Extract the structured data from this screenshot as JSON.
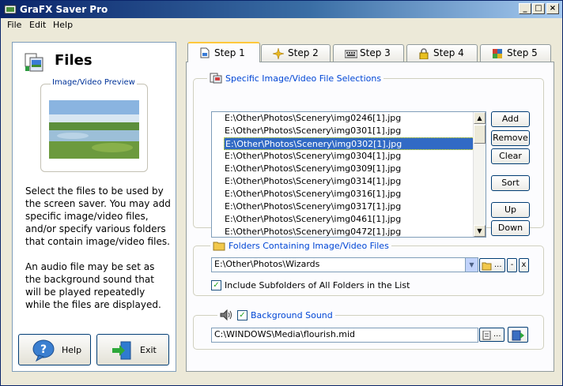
{
  "window": {
    "title": "GraFX Saver Pro",
    "controls": [
      "_",
      "□",
      "×"
    ]
  },
  "menu": [
    "File",
    "Edit",
    "Help"
  ],
  "left": {
    "heading": "Files",
    "preview_label": "Image/Video Preview",
    "desc1": "Select the files to be used by the screen saver. You may add specific image/video files, and/or specify various folders that contain image/video files.",
    "desc2": "An audio file may be set as the background sound that will be played repeatedly while the files are displayed.",
    "help_label": "Help",
    "exit_label": "Exit"
  },
  "tabs": [
    {
      "label": "Step 1",
      "active": true,
      "icon": "file-icon"
    },
    {
      "label": "Step 2",
      "active": false,
      "icon": "sparkle-icon"
    },
    {
      "label": "Step 3",
      "active": false,
      "icon": "keyboard-icon"
    },
    {
      "label": "Step 4",
      "active": false,
      "icon": "lock-icon"
    },
    {
      "label": "Step 5",
      "active": false,
      "icon": "tools-icon"
    }
  ],
  "files": {
    "title": "Specific Image/Video File Selections",
    "items": [
      "E:\\Other\\Photos\\Scenery\\img0246[1].jpg",
      "E:\\Other\\Photos\\Scenery\\img0301[1].jpg",
      "E:\\Other\\Photos\\Scenery\\img0302[1].jpg",
      "E:\\Other\\Photos\\Scenery\\img0304[1].jpg",
      "E:\\Other\\Photos\\Scenery\\img0309[1].jpg",
      "E:\\Other\\Photos\\Scenery\\img0314[1].jpg",
      "E:\\Other\\Photos\\Scenery\\img0316[1].jpg",
      "E:\\Other\\Photos\\Scenery\\img0317[1].jpg",
      "E:\\Other\\Photos\\Scenery\\img0461[1].jpg",
      "E:\\Other\\Photos\\Scenery\\img0472[1].jpg"
    ],
    "selected_index": 2,
    "buttons": {
      "add": "Add",
      "remove": "Remove",
      "clear": "Clear",
      "sort": "Sort",
      "up": "Up",
      "down": "Down"
    }
  },
  "folders": {
    "title": "Folders Containing Image/Video Files",
    "value": "E:\\Other\\Photos\\Wizards",
    "browse": "...",
    "remove": "-",
    "clear": "x",
    "include_label": "Include Subfolders of All Folders in the List",
    "include_checked": true
  },
  "sound": {
    "title": "Background Sound",
    "enabled": true,
    "value": "C:\\WINDOWS\\Media\\flourish.mid",
    "browse": "..."
  }
}
